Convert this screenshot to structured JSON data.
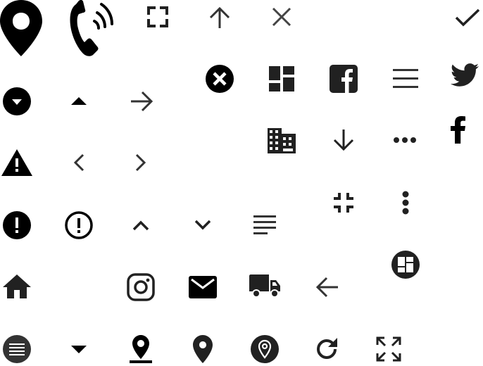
{
  "icons": [
    "map-pin-icon",
    "phone-ringing-icon",
    "fullscreen-icon",
    "arrow-up-icon",
    "close-icon",
    "check-icon",
    "close-circle-icon",
    "dashboard-icon",
    "facebook-square-icon",
    "menu-icon",
    "twitter-icon",
    "dropdown-circle-icon",
    "caret-up-icon",
    "arrow-right-icon",
    "building-icon",
    "arrow-down-icon",
    "more-horizontal-icon",
    "facebook-icon",
    "warning-icon",
    "chevron-left-icon",
    "chevron-right-icon",
    "fullscreen-exit-icon",
    "more-vertical-icon",
    "error-circle-icon",
    "error-outline-icon",
    "chevron-up-icon",
    "chevron-down-icon",
    "notes-icon",
    "dashboard-circle-icon",
    "home-icon",
    "instagram-icon",
    "mail-icon",
    "truck-icon",
    "arrow-left-icon",
    "list-circle-icon",
    "caret-down-icon",
    "location-pin-icon",
    "pin-icon",
    "location-circle-icon",
    "refresh-icon",
    "expand-icon"
  ],
  "colors": {
    "icon_primary": "#000000",
    "icon_dark": "#212121",
    "icon_medium": "#333333",
    "icon_light": "#444444",
    "background": "#ffffff"
  }
}
